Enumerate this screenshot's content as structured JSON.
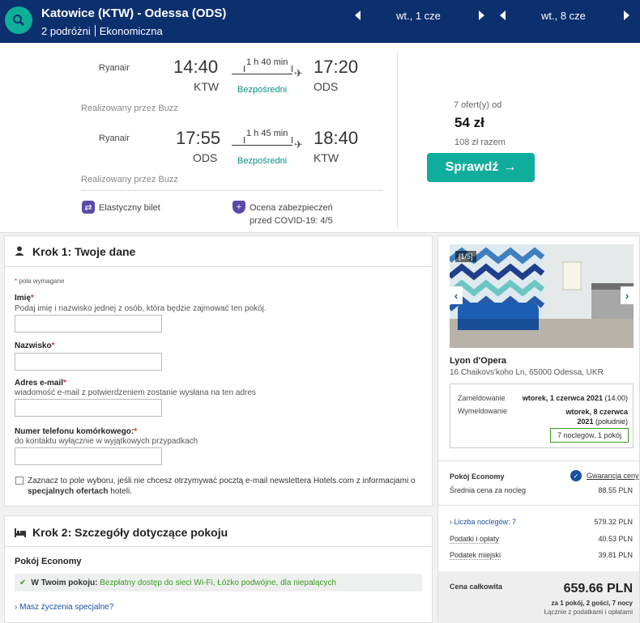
{
  "topbar": {
    "route": "Katowice (KTW) - Odessa (ODS)",
    "travellers": "2 podróżni",
    "cabin": "Ekonomiczna",
    "date_out": "wt., 1 cze",
    "date_back": "wt., 8 cze"
  },
  "flights": [
    {
      "airline": "Ryanair",
      "dep_time": "14:40",
      "dep_code": "KTW",
      "duration": "1 h 40 min",
      "stops": "Bezpośredni",
      "arr_time": "17:20",
      "arr_code": "ODS",
      "operated": "Realizowany przez Buzz"
    },
    {
      "airline": "Ryanair",
      "dep_time": "17:55",
      "dep_code": "ODS",
      "duration": "1 h 45 min",
      "stops": "Bezpośredni",
      "arr_time": "18:40",
      "arr_code": "KTW",
      "operated": "Realizowany przez Buzz"
    }
  ],
  "features": {
    "flexible": "Elastyczny bilet",
    "covid_line1": "Ocena zabezpieczeń",
    "covid_line2": "przed COVID-19: 4/5"
  },
  "offer": {
    "count": "7 ofert(y) od",
    "price": "54 zł",
    "total": "108 zł razem",
    "button": "Sprawdź"
  },
  "step1": {
    "title": "Krok 1: Twoje dane",
    "required_note": "pola wymagane",
    "name_label": "Imię",
    "name_hint": "Podaj imię i nazwisko jednej z osób, która będzie zajmować ten pokój.",
    "surname_label": "Nazwisko",
    "email_label": "Adres e-mail",
    "email_hint": "wiadomość e-mail z potwierdzeniem zostanie wysłana na ten adres",
    "phone_label": "Numer telefonu komórkowego:",
    "phone_hint": "do kontaktu wyłącznie w wyjątkowych przypadkach",
    "newsletter_a": "Zaznacz to pole wyboru, jeśli nie chcesz otrzymywać pocztą e-mail newslettera Hotels.com z informacjami o",
    "newsletter_b": "specjalnych ofertach",
    "newsletter_c": "hoteli."
  },
  "step2": {
    "title": "Krok 2: Szczegóły dotyczące pokoju",
    "room": "Pokój Economy",
    "in_room_label": "W Twoim pokoju:",
    "in_room_items": "Bezpłatny dostęp do sieci Wi-Fi, Łóżko podwójne, dla niepalących",
    "special_requests": "Masz życzenia specjalne?"
  },
  "hotel": {
    "image_counter": "[1/5]",
    "name": "Lyon d'Opera",
    "address": "16 Chaikovs'koho Ln, 65000 Odessa, UKR",
    "checkin_label": "Zameldowanie",
    "checkin_value": "wtorek, 1 czerwca 2021",
    "checkin_time": "(14.00)",
    "checkout_label": "Wymeldowanie",
    "checkout_value_a": "wtorek, 8 czerwca",
    "checkout_value_b": "2021",
    "checkout_time": "(południe)",
    "nights_badge": "7 noclegów, 1 pokój",
    "room_type": "Pokój Economy",
    "guarantee": "Gwarancja ceny",
    "avg_label": "Średnia cena za nocleg",
    "avg_value": "88.55 PLN",
    "nights_label": "Liczba noclegów: 7",
    "nights_value": "579.32 PLN",
    "taxes_label": "Podatki i opłaty",
    "taxes_value": "40.53 PLN",
    "city_tax_label": "Podatek miejski",
    "city_tax_value": "39.81 PLN",
    "total_label": "Cena całkowita",
    "total_value": "659.66 PLN",
    "total_sub1": "za 1 pokój, 2 gości, 7 nocy",
    "total_sub2": "Łącznie z podatkami i opłatami"
  }
}
